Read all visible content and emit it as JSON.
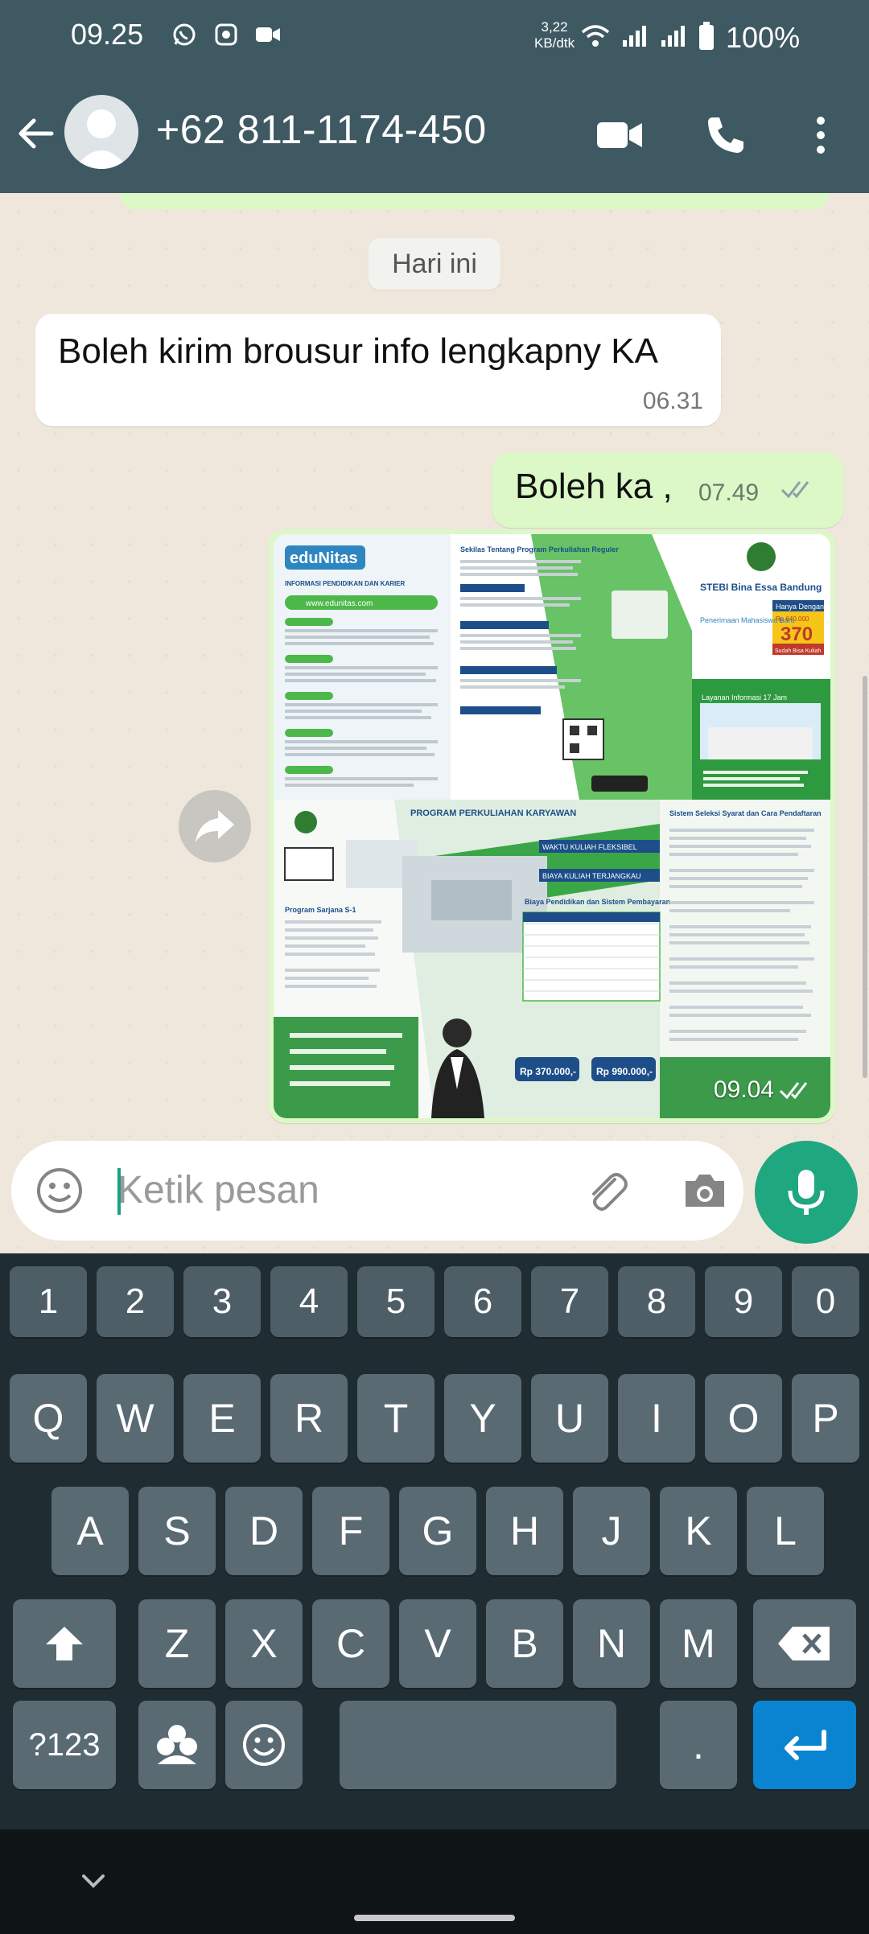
{
  "status_bar": {
    "time": "09.25",
    "speed_value": "3,22",
    "speed_unit": "KB/dtk",
    "battery": "100%"
  },
  "header": {
    "contact_name": "+62 811-1174-450"
  },
  "chat": {
    "date_label": "Hari ini",
    "messages": [
      {
        "text": "Boleh kirim brousur info lengkapny KA",
        "time": "06.31"
      },
      {
        "text": "Boleh ka ,",
        "time": "07.49"
      },
      {
        "time": "09.04"
      }
    ],
    "image": {
      "brand": "eduNitas",
      "left_title": "INFORMASI PENDIDIKAN DAN KARIER",
      "website": "www.edunitas.com",
      "center_title": "Sekilas Tentang Program Perkuliahan Reguler",
      "right_school": "STEBI Bina Essa Bandung",
      "price_label": "Hanya Dengan",
      "price_old": "Rp 640.000",
      "price_new": "370",
      "price_note": "Sudah Bisa Kuliah",
      "penerimaan": "Penerimaan Mahasiswa Baru",
      "program_title": "PROGRAM PERKULIAHAN KARYAWAN",
      "waktu": "WAKTU KULIAH FLEKSIBEL",
      "biaya": "BIAYA KULIAH TERJANGKAU",
      "biaya_section": "Biaya Pendidikan dan Sistem Pembayaran",
      "price1": "Rp 370.000,-",
      "price2": "Rp 990.000,-",
      "seleksi": "Sistem Seleksi Syarat dan Cara Pendaftaran",
      "layanan": "Layanan Informasi 17 Jam",
      "sarjana": "Program Sarjana S-1"
    }
  },
  "composer": {
    "placeholder": "Ketik pesan"
  },
  "keyboard": {
    "row_numbers": [
      "1",
      "2",
      "3",
      "4",
      "5",
      "6",
      "7",
      "8",
      "9",
      "0"
    ],
    "row1": [
      "Q",
      "W",
      "E",
      "R",
      "T",
      "Y",
      "U",
      "I",
      "O",
      "P"
    ],
    "row2": [
      "A",
      "S",
      "D",
      "F",
      "G",
      "H",
      "J",
      "K",
      "L"
    ],
    "row3": [
      "Z",
      "X",
      "C",
      "V",
      "B",
      "N",
      "M"
    ],
    "symbols_key": "?123",
    "period_key": "."
  }
}
